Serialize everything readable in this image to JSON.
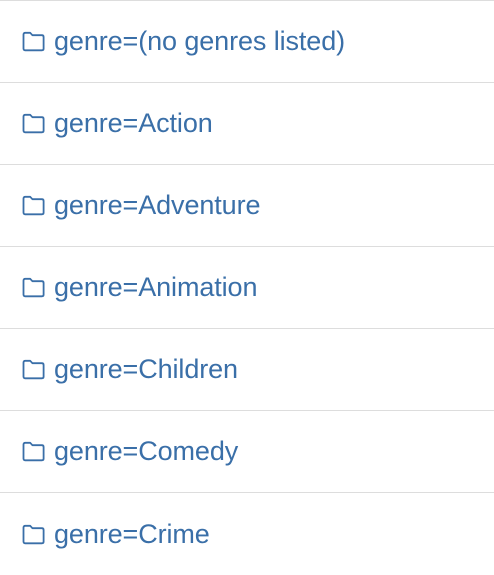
{
  "theme": {
    "link_color": "#3a6fa8",
    "divider_color": "#dddddd",
    "background": "#ffffff"
  },
  "folders": [
    {
      "label": "genre=(no genres listed)",
      "icon": "folder-icon"
    },
    {
      "label": "genre=Action",
      "icon": "folder-icon"
    },
    {
      "label": "genre=Adventure",
      "icon": "folder-icon"
    },
    {
      "label": "genre=Animation",
      "icon": "folder-icon"
    },
    {
      "label": "genre=Children",
      "icon": "folder-icon"
    },
    {
      "label": "genre=Comedy",
      "icon": "folder-icon"
    },
    {
      "label": "genre=Crime",
      "icon": "folder-icon"
    }
  ]
}
